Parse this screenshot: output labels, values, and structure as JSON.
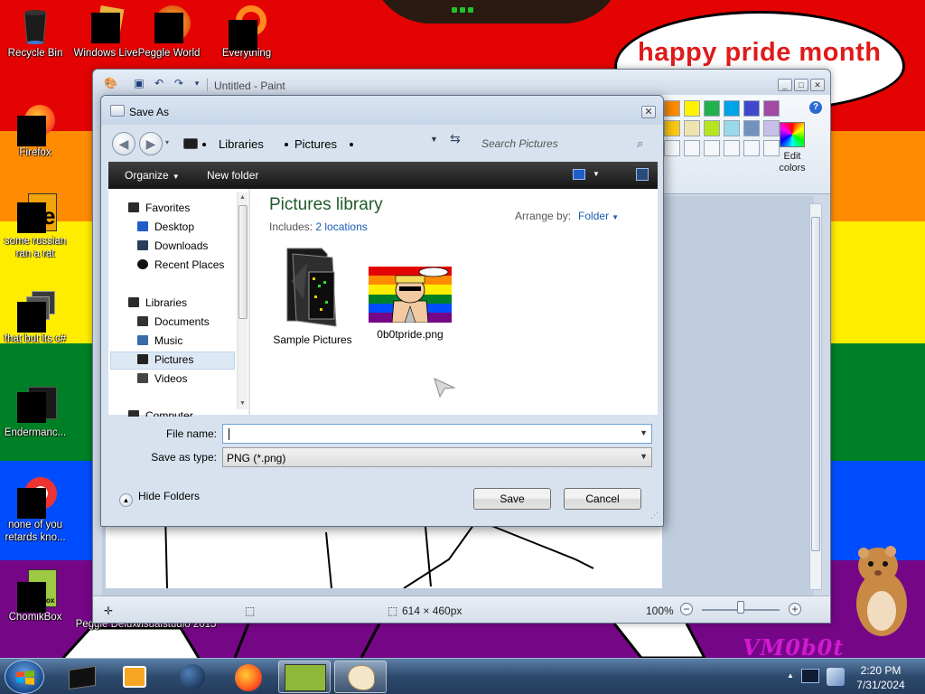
{
  "desktop": {
    "banner_text": "happy pride month",
    "signature": "VM0b0t",
    "icons": [
      {
        "label": "Recycle Bin"
      },
      {
        "label": "Windows Live"
      },
      {
        "label": "Peggle World"
      },
      {
        "label": "Everything"
      },
      {
        "label": "Firefox"
      },
      {
        "label": "some russian ran a rat"
      },
      {
        "label": "that but its c#"
      },
      {
        "label": "Endermanc..."
      },
      {
        "label": "none of you retards kno..."
      },
      {
        "label": "ChomikBox"
      },
      {
        "label": "Peggle Deluxe"
      },
      {
        "label": "visualstudio 2015"
      }
    ]
  },
  "paint": {
    "title": "Untitled - Paint",
    "edit_colors_label": "Edit colors",
    "palette_colors": [
      "#ff8c00",
      "#fff200",
      "#22b14c",
      "#00a2e8",
      "#3f48cc",
      "#a349a4",
      "#ffc90e",
      "#efe4b0",
      "#b5e61d",
      "#99d9ea",
      "#7092be",
      "#c8bfe7"
    ],
    "status": {
      "dimensions": "614 × 460px",
      "zoom": "100%"
    }
  },
  "dialog": {
    "title": "Save As",
    "breadcrumb": [
      "Libraries",
      "Pictures"
    ],
    "search_placeholder": "Search Pictures",
    "toolbar": {
      "organize": "Organize",
      "new_folder": "New folder"
    },
    "nav": {
      "favorites": "Favorites",
      "desktop": "Desktop",
      "downloads": "Downloads",
      "recent": "Recent Places",
      "libraries": "Libraries",
      "documents": "Documents",
      "music": "Music",
      "pictures": "Pictures",
      "videos": "Videos",
      "computer": "Computer"
    },
    "library_title": "Pictures library",
    "includes_label": "Includes:",
    "includes_link": "2 locations",
    "arrange_label": "Arrange by:",
    "arrange_value": "Folder",
    "files": [
      {
        "name": "Sample Pictures"
      },
      {
        "name": "0b0tpride.png"
      }
    ],
    "file_name_label": "File name:",
    "file_name_value": "",
    "save_type_label": "Save as type:",
    "save_type_value": "PNG (*.png)",
    "hide_folders": "Hide Folders",
    "save": "Save",
    "cancel": "Cancel"
  },
  "taskbar": {
    "time": "2:20 PM",
    "date": "7/31/2024"
  }
}
